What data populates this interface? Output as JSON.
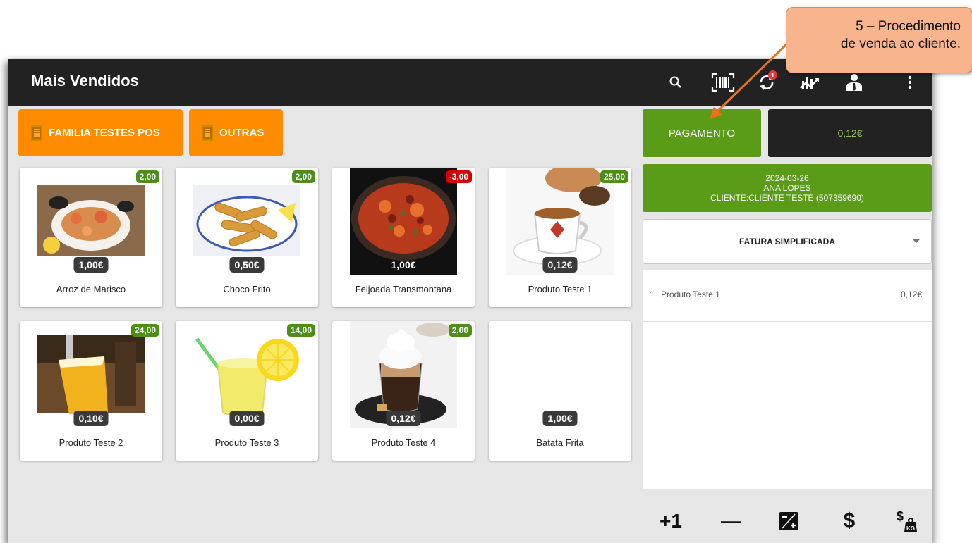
{
  "header": {
    "title": "Mais Vendidos",
    "sync_badge": "1"
  },
  "icons": [
    "search-icon",
    "barcode-icon",
    "sync-icon",
    "chart-icon",
    "user-icon",
    "more-vert-icon"
  ],
  "families": [
    {
      "label": "FAMILIA TESTES POS"
    },
    {
      "label": "OUTRAS"
    }
  ],
  "products": [
    {
      "name": "Arroz de Marisco",
      "price": "1,00€",
      "stock": "2,00",
      "stock_color": "#4b8f15"
    },
    {
      "name": "Choco Frito",
      "price": "0,50€",
      "stock": "2,00",
      "stock_color": "#4b8f15"
    },
    {
      "name": "Feijoada Transmontana",
      "price": "1,00€",
      "stock": "-3,00",
      "stock_color": "#d50000"
    },
    {
      "name": "Produto Teste 1",
      "price": "0,12€",
      "stock": "25,00",
      "stock_color": "#4b8f15"
    },
    {
      "name": "Produto Teste 2",
      "price": "0,10€",
      "stock": "24,00",
      "stock_color": "#4b8f15"
    },
    {
      "name": "Produto Teste 3",
      "price": "0,00€",
      "stock": "14,00",
      "stock_color": "#4b8f15"
    },
    {
      "name": "Produto Teste 4",
      "price": "0,12€",
      "stock": "2,00",
      "stock_color": "#4b8f15"
    },
    {
      "name": "Batata Frita",
      "price": "1,00€",
      "stock": "",
      "stock_color": ""
    }
  ],
  "payment": {
    "label": "PAGAMENTO",
    "total": "0,12€"
  },
  "sale_info": {
    "date": "2024-03-26",
    "operator": "ANA LOPES",
    "client": "CLIENTE:CLIENTE TESTE (507359690)"
  },
  "document_type": {
    "selected": "FATURA SIMPLIFICADA"
  },
  "order_lines": [
    {
      "qty": "1",
      "name": "Produto Teste 1",
      "price": "0,12€"
    }
  ],
  "bottom_actions": [
    {
      "label": "+1"
    },
    {
      "label": "—"
    },
    {
      "label": ""
    },
    {
      "label": "$"
    },
    {
      "label": ""
    }
  ],
  "colors": {
    "accent_orange": "#ff8c00",
    "accent_green": "#5a9b17",
    "topbar": "#222222",
    "callout": "#f8b48c",
    "arrow": "#e8731a"
  },
  "callout": {
    "line1": "5 – Procedimento",
    "line2": "de venda ao cliente."
  }
}
